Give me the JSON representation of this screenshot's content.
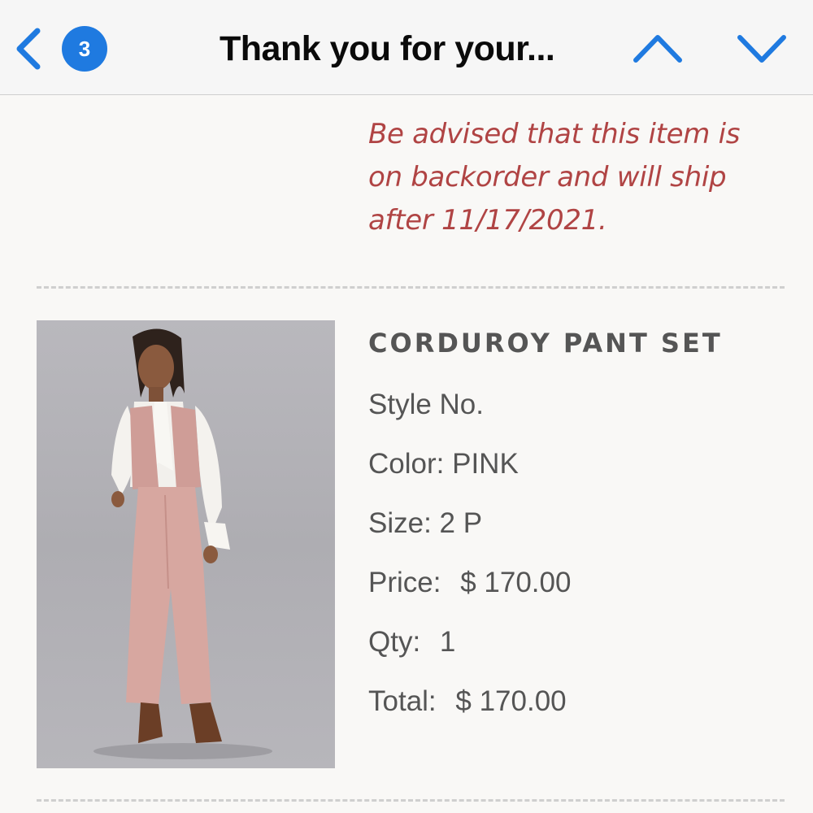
{
  "nav": {
    "back_icon": "chevron-left-icon",
    "unread_count": "3",
    "title": "Thank you for your...",
    "prev_icon": "chevron-up-icon",
    "next_icon": "chevron-down-icon",
    "accent_color": "#1f7ae0"
  },
  "notice": {
    "lines": [
      "Be advised that this item is",
      "on backorder and will ship",
      "after 11/17/2021."
    ],
    "color": "#b04444"
  },
  "product": {
    "name": "CORDUROY PANT SET",
    "style_label": "Style No.",
    "color_label": "Color:",
    "color_value": "PINK",
    "size_label": "Size:",
    "size_value": "2 P",
    "price_label": "Price:",
    "price_value": "$ 170.00",
    "qty_label": "Qty:",
    "qty_value": "1",
    "total_label": "Total:",
    "total_value": "$ 170.00"
  }
}
